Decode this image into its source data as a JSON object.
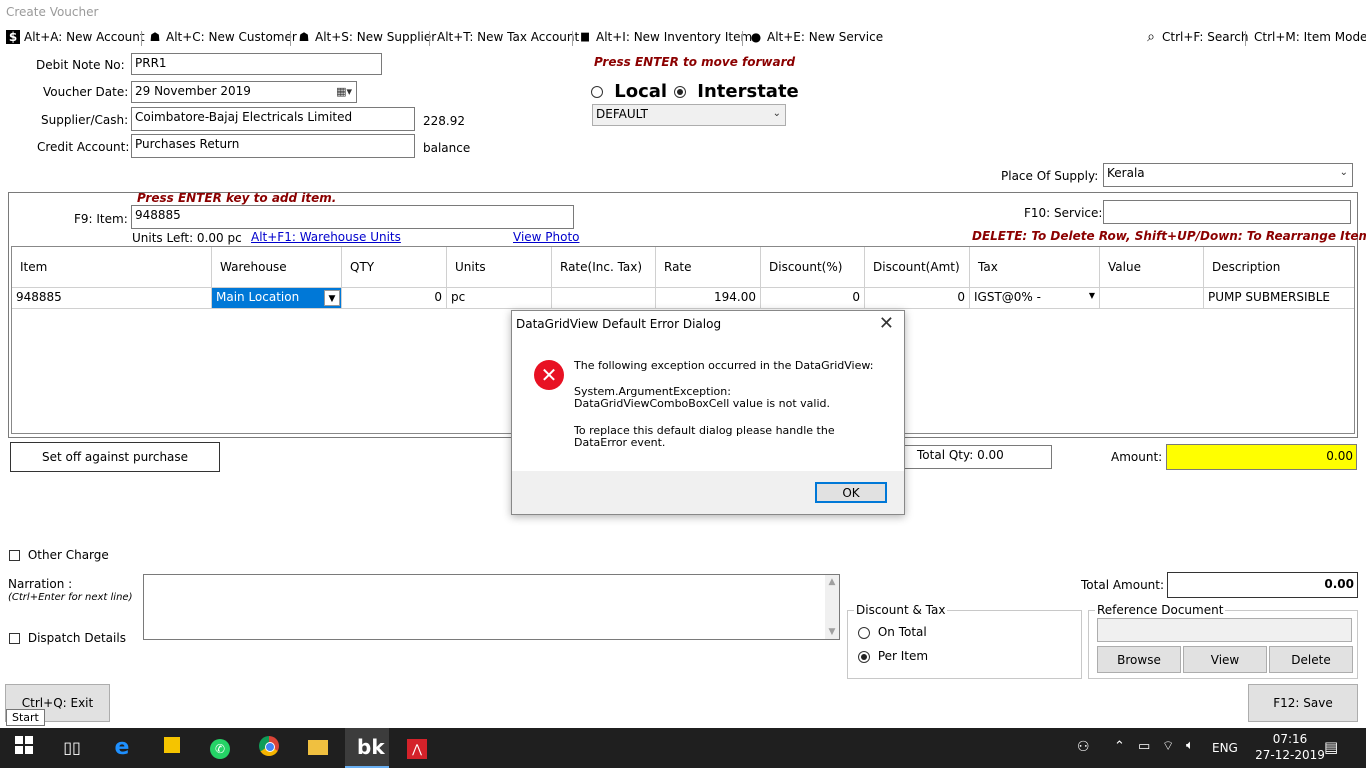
{
  "window": {
    "title": "Create Voucher"
  },
  "toolbar": [
    {
      "icon": "dollar-icon",
      "glyph": "$",
      "label": "Alt+A: New Account"
    },
    {
      "icon": "customer-icon",
      "glyph": "☗",
      "label": "Alt+C: New Customer"
    },
    {
      "icon": "supplier-icon",
      "glyph": "☗",
      "label": "Alt+S: New Supplier"
    },
    {
      "icon": "",
      "glyph": "",
      "label": "Alt+T: New Tax Account"
    },
    {
      "icon": "truck-icon",
      "glyph": "▆",
      "label": "Alt+I: New Inventory Item"
    },
    {
      "icon": "service-icon",
      "glyph": "●",
      "label": "Alt+E: New Service"
    },
    {
      "icon": "search-icon",
      "glyph": "⌕",
      "label": "Ctrl+F: Search"
    },
    {
      "icon": "",
      "glyph": "",
      "label": "Ctrl+M: Item Mode"
    }
  ],
  "form": {
    "debit_note_label": "Debit Note No:",
    "debit_note_value": "PRR1",
    "voucher_date_label": "Voucher Date:",
    "voucher_date_value": "29 November 2019",
    "supplier_label": "Supplier/Cash:",
    "supplier_value": "Coimbatore-Bajaj Electricals Limited",
    "supplier_balance": "228.92",
    "credit_account_label": "Credit Account:",
    "credit_account_value": "Purchases Return",
    "balance_label": "balance",
    "press_enter_hint": "Press ENTER to move forward",
    "local_label": "Local",
    "interstate_label": "Interstate",
    "tax_mode_selected": "Interstate",
    "default_value": "DEFAULT",
    "place_of_supply_label": "Place Of Supply:",
    "place_of_supply_value": "Kerala"
  },
  "item_panel": {
    "hint": "Press ENTER key to add item.",
    "item_label": "F9: Item:",
    "item_value": "948885",
    "units_left": "Units Left: 0.00 pc",
    "warehouse_units_link": "Alt+F1: Warehouse Units",
    "view_photo_link": "View Photo",
    "service_label": "F10: Service:",
    "service_value": "",
    "delete_hint": "DELETE: To Delete Row, Shift+UP/Down: To Rearrange Items"
  },
  "grid": {
    "columns": [
      "Item",
      "Warehouse",
      "QTY",
      "Units",
      "Rate(Inc. Tax)",
      "Rate",
      "Discount(%)",
      "Discount(Amt)",
      "Tax",
      "Value",
      "Description"
    ],
    "rows": [
      {
        "item": "948885",
        "warehouse": "Main Location",
        "qty": "0",
        "units": "pc",
        "rate_inc_tax": "",
        "rate": "194.00",
        "discount_pct": "0",
        "discount_amt": "0",
        "tax": "IGST@0% -",
        "value": "",
        "description": "PUMP SUBMERSIBLE"
      }
    ]
  },
  "summary": {
    "set_off_button": "Set off against purchase",
    "total_qty": "Total Qty: 0.00",
    "amount_label": "Amount:",
    "amount_value": "0.00",
    "other_charge_label": "Other Charge",
    "narration_label": "Narration :",
    "narration_hint": "(Ctrl+Enter for next line)",
    "narration_value": "",
    "dispatch_label": "Dispatch Details",
    "total_amount_label": "Total Amount:",
    "total_amount_value": "0.00"
  },
  "discount_tax": {
    "legend": "Discount & Tax",
    "on_total": "On Total",
    "per_item": "Per Item",
    "selected": "Per Item"
  },
  "reference": {
    "legend": "Reference Document",
    "value": "",
    "browse": "Browse",
    "view": "View",
    "delete": "Delete"
  },
  "buttons": {
    "exit": "Ctrl+Q: Exit",
    "save": "F12: Save",
    "start_tooltip": "Start"
  },
  "dialog": {
    "title": "DataGridView Default Error Dialog",
    "line1": "The following exception occurred in the DataGridView:",
    "line2": "System.ArgumentException: DataGridViewComboBoxCell value is not valid.",
    "line3": "To replace this default dialog please handle the DataError event.",
    "ok": "OK"
  },
  "taskbar": {
    "language": "ENG",
    "time": "07:16",
    "date": "27-12-2019"
  },
  "colors": {
    "hint_red": "#8b0000",
    "amount_bg": "#ffff00",
    "selected_cell": "#0078d7",
    "error_red": "#e81123",
    "taskbar_bg": "#1f1f1f"
  }
}
